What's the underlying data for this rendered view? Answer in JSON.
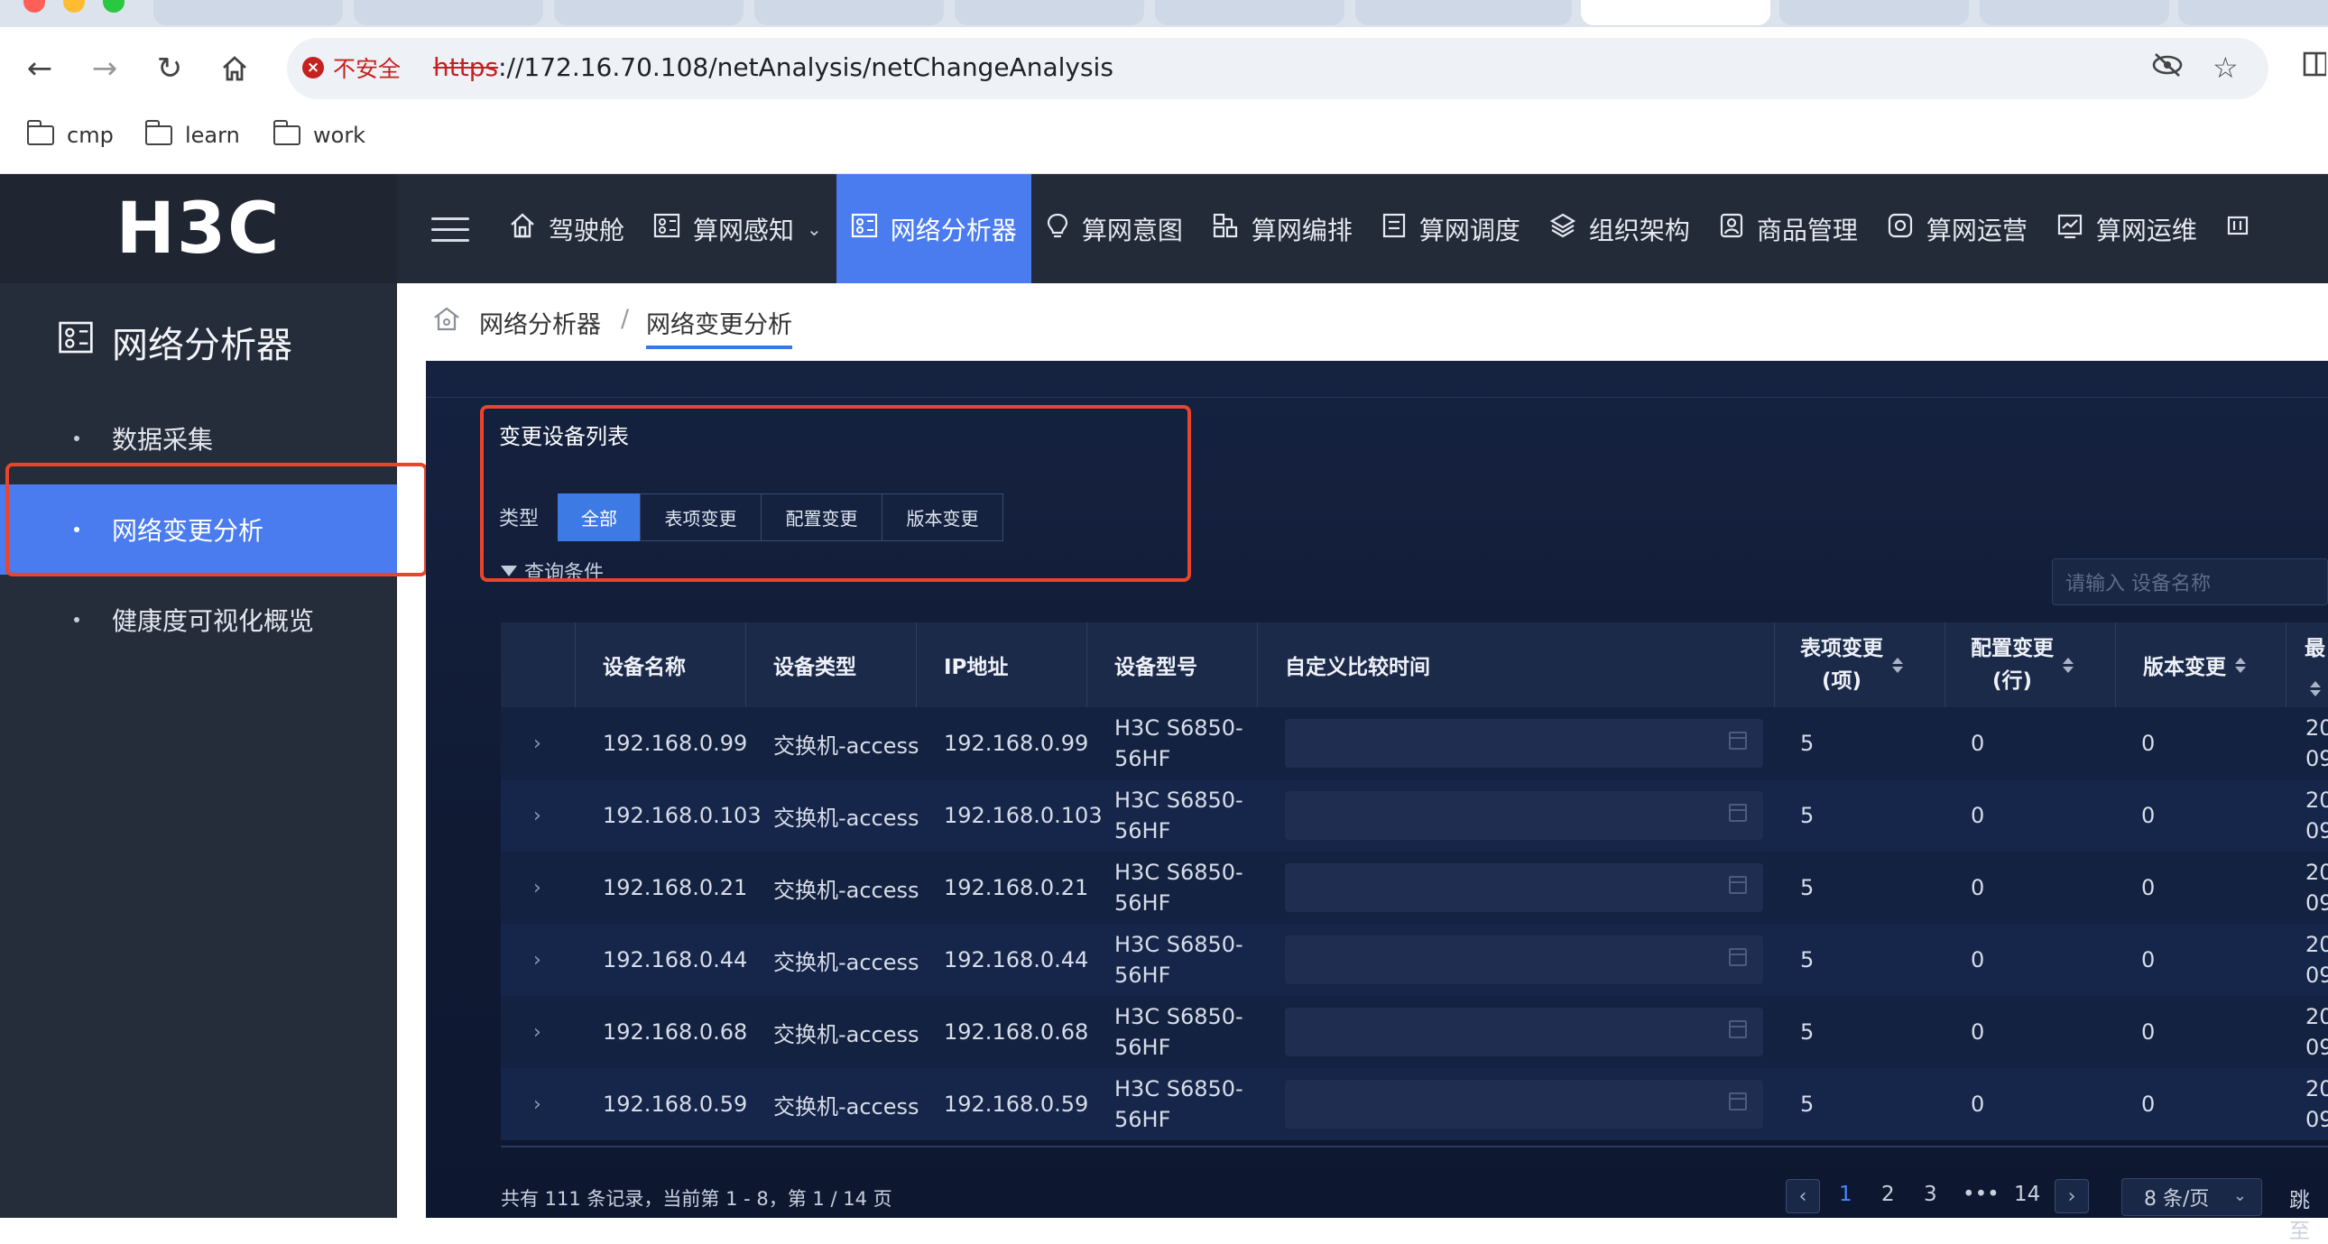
{
  "browser": {
    "insecure_label": "不安全",
    "url_scheme": "https",
    "url_rest": "://172.16.70.108/netAnalysis/netChangeAnalysis",
    "bookmarks": [
      {
        "label": "cmp"
      },
      {
        "label": "learn"
      },
      {
        "label": "work"
      }
    ]
  },
  "header": {
    "logo": "H3C",
    "nav": [
      {
        "label": "驾驶舱",
        "icon": "home-icon"
      },
      {
        "label": "算网感知",
        "icon": "topology-icon",
        "dropdown": true
      },
      {
        "label": "网络分析器",
        "icon": "topology-icon",
        "active": true
      },
      {
        "label": "算网意图",
        "icon": "bulb-icon"
      },
      {
        "label": "算网编排",
        "icon": "orchestrate-icon"
      },
      {
        "label": "算网调度",
        "icon": "schedule-icon"
      },
      {
        "label": "组织架构",
        "icon": "layers-icon"
      },
      {
        "label": "商品管理",
        "icon": "user-card-icon"
      },
      {
        "label": "算网运营",
        "icon": "operate-icon"
      },
      {
        "label": "算网运维",
        "icon": "chart-monitor-icon"
      }
    ]
  },
  "sidebar": {
    "title": "网络分析器",
    "items": [
      {
        "label": "数据采集"
      },
      {
        "label": "网络变更分析",
        "active": true
      },
      {
        "label": "健康度可视化概览"
      }
    ]
  },
  "breadcrumb": {
    "root": "网络分析器",
    "separator": "/",
    "current": "网络变更分析"
  },
  "panel": {
    "title": "变更设备列表",
    "type_label": "类型",
    "types": [
      "全部",
      "表项变更",
      "配置变更",
      "版本变更"
    ],
    "selected_type": "全部",
    "query_label": "查询条件",
    "search_placeholder": "请输入 设备名称"
  },
  "table": {
    "columns": [
      "设备名称",
      "设备类型",
      "IP地址",
      "设备型号",
      "自定义比较时间",
      "表项变更",
      "(项)",
      "配置变更",
      "(行)",
      "版本变更",
      "最"
    ],
    "rows": [
      {
        "name": "192.168.0.99",
        "type": "交换机-access",
        "ip": "192.168.0.99",
        "model_l1": "H3C S6850-",
        "model_l2": "56HF",
        "entry": "5",
        "config": "0",
        "version": "0",
        "last_l1": "20",
        "last_l2": "09"
      },
      {
        "name": "192.168.0.103",
        "type": "交换机-access",
        "ip": "192.168.0.103",
        "model_l1": "H3C S6850-",
        "model_l2": "56HF",
        "entry": "5",
        "config": "0",
        "version": "0",
        "last_l1": "20",
        "last_l2": "09"
      },
      {
        "name": "192.168.0.21",
        "type": "交换机-access",
        "ip": "192.168.0.21",
        "model_l1": "H3C S6850-",
        "model_l2": "56HF",
        "entry": "5",
        "config": "0",
        "version": "0",
        "last_l1": "20",
        "last_l2": "09"
      },
      {
        "name": "192.168.0.44",
        "type": "交换机-access",
        "ip": "192.168.0.44",
        "model_l1": "H3C S6850-",
        "model_l2": "56HF",
        "entry": "5",
        "config": "0",
        "version": "0",
        "last_l1": "20",
        "last_l2": "09"
      },
      {
        "name": "192.168.0.68",
        "type": "交换机-access",
        "ip": "192.168.0.68",
        "model_l1": "H3C S6850-",
        "model_l2": "56HF",
        "entry": "5",
        "config": "0",
        "version": "0",
        "last_l1": "20",
        "last_l2": "09"
      },
      {
        "name": "192.168.0.59",
        "type": "交换机-access",
        "ip": "192.168.0.59",
        "model_l1": "H3C S6850-",
        "model_l2": "56HF",
        "entry": "5",
        "config": "0",
        "version": "0",
        "last_l1": "20",
        "last_l2": "09"
      }
    ]
  },
  "pagination": {
    "summary": "共有 111 条记录，当前第 1 - 8，第 1 / 14 页",
    "pages": [
      "1",
      "2",
      "3",
      "•••",
      "14"
    ],
    "current_page": "1",
    "page_size": "8 条/页",
    "jump_label": "跳至"
  },
  "colors": {
    "accent": "#4a7cf0",
    "highlight_border": "#e8452c",
    "header_bg": "#232a38",
    "panel_bg": "#101a33"
  }
}
